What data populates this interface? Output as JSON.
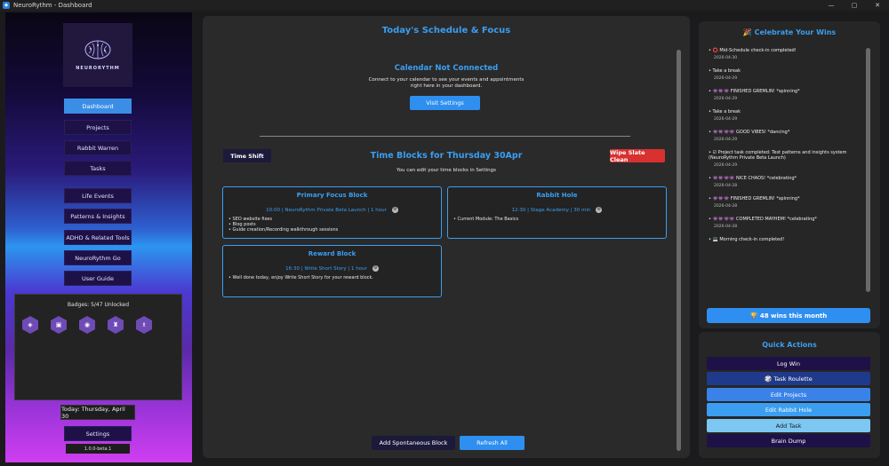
{
  "window": {
    "title": "NeuroRythm - Dashboard",
    "minimize": "—",
    "maximize": "▢",
    "close": "✕"
  },
  "sidebar": {
    "logo_text": "NEURORYTHM",
    "nav": [
      {
        "label": "Dashboard",
        "active": true
      },
      {
        "label": "Projects"
      },
      {
        "label": "Rabbit Warren"
      },
      {
        "label": "Tasks"
      },
      {
        "label": "Life Events"
      },
      {
        "label": "Patterns & Insights"
      },
      {
        "label": "ADHD & Related Tools"
      },
      {
        "label": "NeuroRythm Go"
      },
      {
        "label": "User Guide"
      }
    ],
    "badges_title": "Badges: 5/47 Unlocked",
    "badges": [
      "◈",
      "▣",
      "◉",
      "♜",
      "♗"
    ],
    "today": "Today: Thursday, April 30",
    "settings": "Settings",
    "version": "1.0.0-beta.1"
  },
  "center": {
    "title": "Today's Schedule & Focus",
    "calendar_title": "Calendar Not Connected",
    "calendar_line1": "Connect to your calendar to see your events and appointments",
    "calendar_line2": "right here in your dashboard.",
    "visit_settings": "Visit Settings",
    "time_shift": "Time Shift",
    "blocks_title": "Time Blocks for Thursday 30Apr",
    "blocks_subtitle": "You can edit your time blocks in Settings",
    "wipe": "Wipe Slate Clean",
    "gear_glyph": "⚙",
    "blocks": [
      {
        "title": "Primary Focus Block",
        "meta": "10:00 | NeuroRythm Private Beta Launch | 1 hour",
        "items": [
          "• SEO website fixes",
          "• Blog posts",
          "• Guide creation/Recording walkthrough sessions"
        ]
      },
      {
        "title": "Rabbit Hole",
        "meta": "12:30 | Stage Academy | 30 min",
        "items": [
          "• Current Module: The Basics"
        ]
      },
      {
        "title": "Reward Block",
        "meta": "16:30 | Write Short Story | 1 hour",
        "items": [
          "• Well done today, enjoy Write Short Story for your reward block."
        ]
      }
    ],
    "add_spontaneous": "Add Spontaneous Block",
    "refresh_all": "Refresh All"
  },
  "wins": {
    "title": "🎉 Celebrate Your Wins",
    "items": [
      {
        "text": "• ⭕ Mid-Schedule check-in completed!",
        "date": "2026-04-30"
      },
      {
        "text": "• Take a break",
        "date": "2026-04-29"
      },
      {
        "text": "• 👾👾👾 FINISHED GREMLIN! *spinning*",
        "date": "2026-04-29"
      },
      {
        "text": "• Take a break",
        "date": "2026-04-29"
      },
      {
        "text": "• 👾👾👾👾 GOOD VIBES! *dancing*",
        "date": "2026-04-29"
      },
      {
        "text": "• ☑ Project task completed: Test patterns and insights system (NeuroRythm Private Beta Launch)",
        "date": "2026-04-29"
      },
      {
        "text": "• 👾👾👾👾 NICE CHAOS! *celebrating*",
        "date": "2026-04-28"
      },
      {
        "text": "• 👾👾👾 FINISHED GREMLIN! *spinning*",
        "date": "2026-04-28"
      },
      {
        "text": "• 👾👾👾👾 COMPLETED MAYHEM! *celebrating*",
        "date": "2026-04-28"
      },
      {
        "text": "• 💻 Morning check-in completed!",
        "date": ""
      }
    ],
    "count": "🏆 48 wins this month"
  },
  "quick_actions": {
    "title": "Quick Actions",
    "buttons": [
      {
        "label": "Log Win",
        "bg": "#1e1148",
        "fg": "#ffffff"
      },
      {
        "label": "🎲 Task Roulette",
        "bg": "#1f3a8a",
        "fg": "#ffffff"
      },
      {
        "label": "Edit Projects",
        "bg": "#3b82e8",
        "fg": "#ffffff"
      },
      {
        "label": "Edit Rabbit Hole",
        "bg": "#3b9ef0",
        "fg": "#ffffff"
      },
      {
        "label": "Add Task",
        "bg": "#7cc8f2",
        "fg": "#1a1a1a"
      },
      {
        "label": "Brain Dump",
        "bg": "#1e1148",
        "fg": "#ffffff"
      }
    ]
  }
}
